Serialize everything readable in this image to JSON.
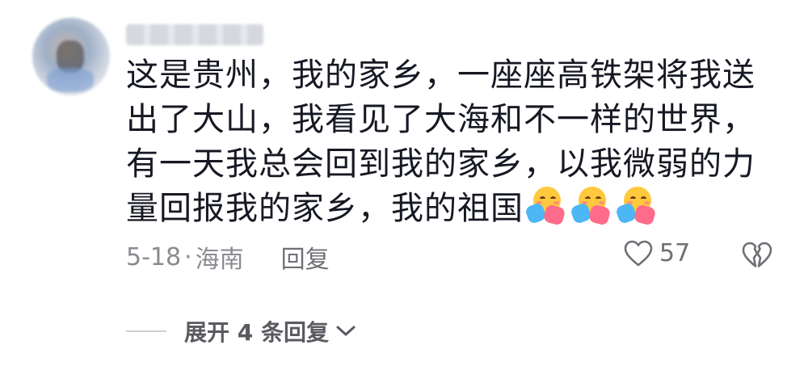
{
  "comment": {
    "username_text": "",
    "body": "这是贵州，我的家乡，一座座高铁架将我送出了大山，我看见了大海和不一样的世界，有一天我总会回到我的家乡，以我微弱的力量回报我的家乡，我的祖国",
    "emojis": [
      "hug-emoji",
      "hug-emoji",
      "hug-emoji"
    ],
    "date": "5-18",
    "separator": "·",
    "location": "海南",
    "reply_label": "回复",
    "like_count": "57",
    "expand_label": "展开 4 条回复"
  },
  "colors": {
    "text_primary": "#161823",
    "text_secondary": "#8a8b91",
    "icon": "#6f7076"
  },
  "icons": {
    "like": "heart-outline-icon",
    "dislike": "broken-heart-outline-icon",
    "expand": "chevron-down-icon"
  }
}
